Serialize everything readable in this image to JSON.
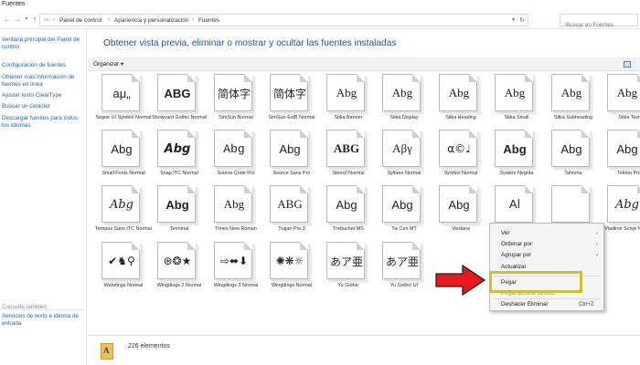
{
  "window": {
    "title": "Fuentes"
  },
  "address": {
    "crumbs": [
      "Panel de control",
      "Apariencia y personalización",
      "Fuentes"
    ],
    "search_placeholder": "Buscar en Fuentes"
  },
  "left_panel": {
    "main_link": "Ventana principal del Panel de control",
    "tasks": [
      "Configuración de fuentes",
      "Obtener más información de fuentes en línea",
      "Ajustar texto ClearType",
      "Buscar un carácter",
      "Descargar fuentes para todos los idiomas"
    ],
    "see_also_title": "Consulta también",
    "see_also_link": "Servicios de texto e idioma de entrada"
  },
  "main": {
    "heading": "Obtener vista previa, eliminar o mostrar y ocultar las fuentes instaladas",
    "toolbar": {
      "organize": "Organizar ▾"
    }
  },
  "fonts": [
    {
      "sample": "aμ„",
      "name": "Segoe UI Symbol Normal",
      "style": "s-sans"
    },
    {
      "sample": "ABG",
      "name": "Showcard Gothic Normal",
      "style": "s-bold"
    },
    {
      "sample": "简体字",
      "name": "SimSun Normal",
      "style": "s-cjk"
    },
    {
      "sample": "简体字",
      "name": "SimSun-ExtB Normal",
      "style": "s-cjk"
    },
    {
      "sample": "Abg",
      "name": "Sitka Banner",
      "style": "s-serif"
    },
    {
      "sample": "Abg",
      "name": "Sitka Display",
      "style": "s-serif"
    },
    {
      "sample": "Abg",
      "name": "Sitka Heading",
      "style": "s-serif"
    },
    {
      "sample": "Abg",
      "name": "Sitka Small",
      "style": "s-serif"
    },
    {
      "sample": "Abg",
      "name": "Sitka Subheading",
      "style": "s-serif"
    },
    {
      "sample": "Abg",
      "name": "Sitka Text",
      "style": "s-serif"
    },
    {
      "sample": "Abg",
      "name": "Small Fonts Normal",
      "style": "s-sans"
    },
    {
      "sample": "Abg",
      "name": "Snap ITC Normal",
      "style": "s-heavy"
    },
    {
      "sample": "Abg",
      "name": "Source Code Pro",
      "style": "s-mono"
    },
    {
      "sample": "Abg",
      "name": "Source Sans Pro",
      "style": "s-sans"
    },
    {
      "sample": "ABG",
      "name": "Stencil Normal",
      "style": "s-serifb"
    },
    {
      "sample": "Aβγ",
      "name": "Sylfaen Normal",
      "style": "s-serif"
    },
    {
      "sample": "α©♩",
      "name": "Symbol Normal",
      "style": "s-sym"
    },
    {
      "sample": "Abg",
      "name": "System Negrita",
      "style": "s-bold"
    },
    {
      "sample": "Abg",
      "name": "Tahoma",
      "style": "s-sans"
    },
    {
      "sample": "Abg",
      "name": "Tekton Pro",
      "style": "s-sans"
    },
    {
      "sample": "Abg",
      "name": "Tempus Sans ITC Normal",
      "style": "s-italic"
    },
    {
      "sample": "Abg",
      "name": "Terminal",
      "style": "s-bold"
    },
    {
      "sample": "Abg",
      "name": "Times New Roman",
      "style": "s-serif"
    },
    {
      "sample": "ABG",
      "name": "Trajan Pro 3",
      "style": "s-serif"
    },
    {
      "sample": "Abg",
      "name": "Trebuchet MS",
      "style": "s-sans"
    },
    {
      "sample": "Abg",
      "name": "Tw Cen MT",
      "style": "s-sans"
    },
    {
      "sample": "Abg",
      "name": "Verdana",
      "style": "s-sans"
    },
    {
      "sample": "Aا",
      "name": "",
      "style": "s-sans"
    },
    {
      "sample": "",
      "name": "",
      "style": "s-sans"
    },
    {
      "sample": "Abg",
      "name": "Vladimir Script Normal",
      "style": "s-italic"
    },
    {
      "sample": "✔♞⚲",
      "name": "Webdings Normal",
      "style": "s-sym"
    },
    {
      "sample": "⊛❂★",
      "name": "Wingdings 2 Normal",
      "style": "s-sym"
    },
    {
      "sample": "⇨⬌⬇",
      "name": "Wingdings 3 Normal",
      "style": "s-sym"
    },
    {
      "sample": "✺❋☼",
      "name": "Wingdings Normal",
      "style": "s-sym"
    },
    {
      "sample": "あア亜",
      "name": "Yu Gothic",
      "style": "s-cjk"
    },
    {
      "sample": "あア亜",
      "name": "Yu Gothic UI",
      "style": "s-cjk"
    }
  ],
  "status": {
    "count": "226 elementos"
  },
  "context_menu": {
    "items": [
      {
        "label": "Ver",
        "submenu": true,
        "disabled": false
      },
      {
        "label": "Ordenar por",
        "submenu": true,
        "disabled": false
      },
      {
        "label": "Agrupar por",
        "submenu": true,
        "disabled": false
      },
      {
        "label": "Actualizar",
        "submenu": false,
        "disabled": false
      },
      {
        "label": "Pegar",
        "submenu": false,
        "disabled": false
      },
      {
        "label": "Pegar acceso directo",
        "submenu": false,
        "disabled": true
      },
      {
        "label": "Deshacer Eliminar",
        "shortcut": "Ctrl+Z",
        "submenu": false,
        "disabled": false
      }
    ]
  },
  "colors": {
    "link": "#2262a8",
    "heading": "#1e4f96",
    "highlight": "#c9c42a",
    "arrow": "#e8191e"
  }
}
